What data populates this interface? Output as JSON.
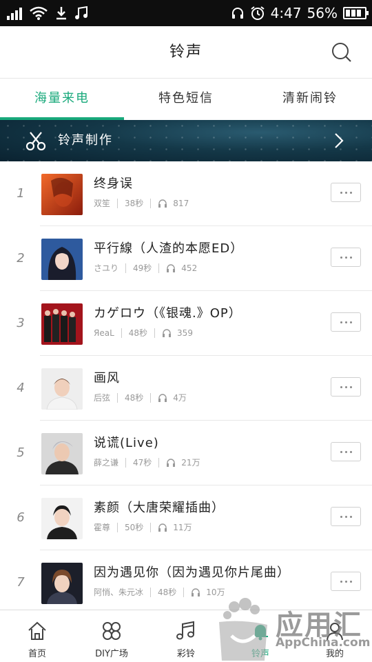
{
  "status_bar": {
    "time": "4:47",
    "battery": "56%"
  },
  "header": {
    "title": "铃声"
  },
  "tabs": [
    {
      "label": "海量来电",
      "active": true
    },
    {
      "label": "特色短信",
      "active": false
    },
    {
      "label": "清新闹铃",
      "active": false
    }
  ],
  "banner": {
    "label": "铃声制作"
  },
  "songs": [
    {
      "rank": "1",
      "title": "终身误",
      "artist": "双笙",
      "duration": "38秒",
      "plays": "817"
    },
    {
      "rank": "2",
      "title": "平行線（人渣的本愿ED）",
      "artist": "さユり",
      "duration": "49秒",
      "plays": "452"
    },
    {
      "rank": "3",
      "title": "カゲロウ（《银魂.》OP）",
      "artist": "ЯeaL",
      "duration": "48秒",
      "plays": "359"
    },
    {
      "rank": "4",
      "title": "画风",
      "artist": "后弦",
      "duration": "48秒",
      "plays": "4万"
    },
    {
      "rank": "5",
      "title": "说谎(Live)",
      "artist": "薛之谦",
      "duration": "47秒",
      "plays": "21万"
    },
    {
      "rank": "6",
      "title": "素颜（大唐荣耀插曲）",
      "artist": "霍尊",
      "duration": "50秒",
      "plays": "11万"
    },
    {
      "rank": "7",
      "title": "因为遇见你（因为遇见你片尾曲）",
      "artist": "阿悄、朱元冰",
      "duration": "48秒",
      "plays": "10万"
    }
  ],
  "bottom_nav": [
    {
      "label": "首页",
      "icon": "home-icon"
    },
    {
      "label": "DIY广场",
      "icon": "diy-icon"
    },
    {
      "label": "彩铃",
      "icon": "music-note-icon"
    },
    {
      "label": "铃声",
      "icon": "bell-icon",
      "active": true
    },
    {
      "label": "我的",
      "icon": "user-icon"
    }
  ],
  "watermark": {
    "name": "应用汇",
    "site": "AppChina.com"
  },
  "colors": {
    "accent": "#19a97b",
    "statusbar": "#0e0e0e"
  }
}
